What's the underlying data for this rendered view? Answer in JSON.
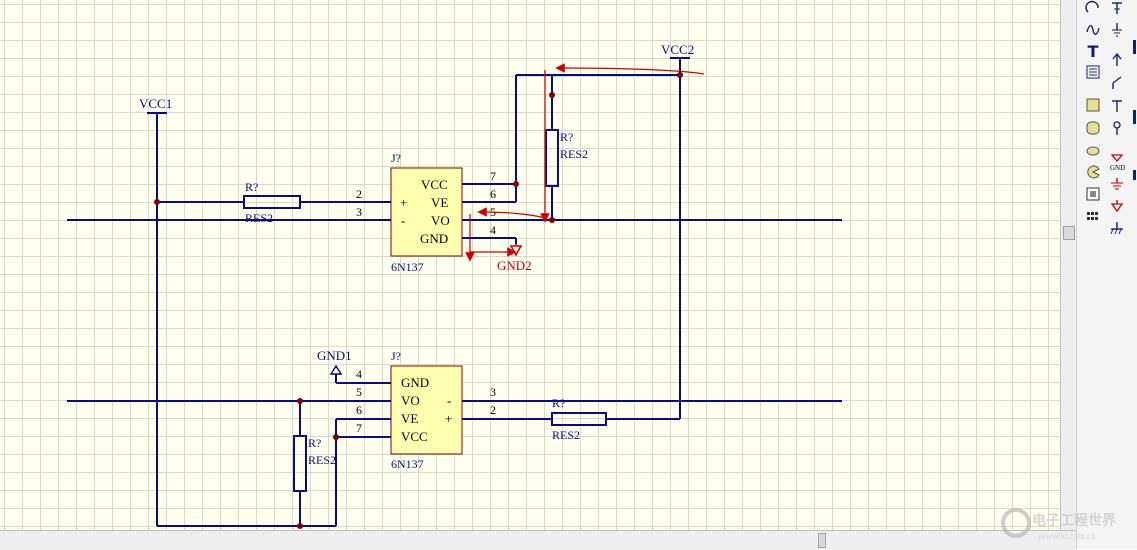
{
  "power": {
    "vcc1": "VCC1",
    "vcc2": "VCC2",
    "gnd1": "GND1",
    "gnd2": "GND2"
  },
  "top_ic": {
    "designator": "J?",
    "part": "6N137",
    "pins_left": [
      {
        "num": "2",
        "sign": "+"
      },
      {
        "num": "3",
        "sign": "-"
      }
    ],
    "pins_right": [
      {
        "num": "7",
        "label": "VCC"
      },
      {
        "num": "6",
        "label": "VE"
      },
      {
        "num": "5",
        "label": "VO"
      },
      {
        "num": "4",
        "label": "GND"
      }
    ]
  },
  "bottom_ic": {
    "designator": "J?",
    "part": "6N137",
    "pins_left": [
      {
        "num": "4",
        "label": "GND"
      },
      {
        "num": "5",
        "label": "VO"
      },
      {
        "num": "6",
        "label": "VE"
      },
      {
        "num": "7",
        "label": "VCC"
      }
    ],
    "pins_right": [
      {
        "num": "3",
        "sign": "-"
      },
      {
        "num": "2",
        "sign": "+"
      }
    ]
  },
  "resistors": {
    "r_input_top": {
      "designator": "R?",
      "value": "RES2"
    },
    "r_pullup_top": {
      "designator": "R?",
      "value": "RES2"
    },
    "r_pullup_bottom": {
      "designator": "R?",
      "value": "RES2"
    },
    "r_input_bottom": {
      "designator": "R?",
      "value": "RES2"
    }
  },
  "colors": {
    "wire": "#0a0a80",
    "component_fill": "#ffffb0",
    "component_border": "#800000",
    "annotation": "#cc0000",
    "grid": "#d8d8c8",
    "background": "#fffff0"
  },
  "toolbox_icons": [
    "arc-icon",
    "power-port-icon",
    "sine-icon",
    "ground-port-icon",
    "text-icon",
    "input-port-icon",
    "text-frame-icon",
    "bus-entry-icon",
    "rectangle-icon",
    "no-connect-icon",
    "rounded-rect-icon",
    "probe-icon",
    "ellipse-icon",
    "gnd-icon",
    "pie-icon",
    "signal-ground-icon",
    "graphic-icon",
    "earth-icon",
    "array-icon",
    "chassis-ground-icon"
  ],
  "watermark": {
    "text": "电子工程世界",
    "sub": "eeworld.com.cn"
  }
}
